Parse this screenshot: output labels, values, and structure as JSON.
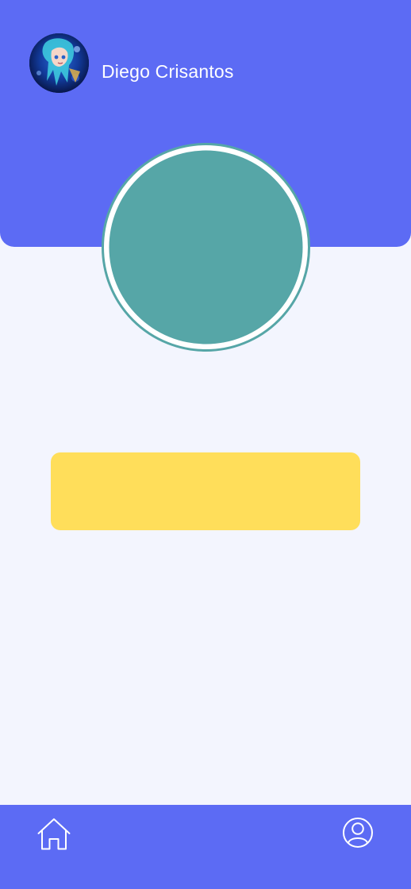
{
  "header": {
    "user_name": "Diego Crisantos",
    "avatar_icon": "user-avatar-image"
  },
  "main": {
    "circle_color": "#56a6a7",
    "card_color": "#ffde5a"
  },
  "bottom_nav": {
    "items": [
      {
        "icon": "home-icon"
      },
      {
        "icon": "profile-icon"
      }
    ]
  },
  "colors": {
    "primary": "#5c6bf4",
    "background": "#f3f5fe",
    "teal": "#56a6a7",
    "yellow": "#ffde5a"
  }
}
